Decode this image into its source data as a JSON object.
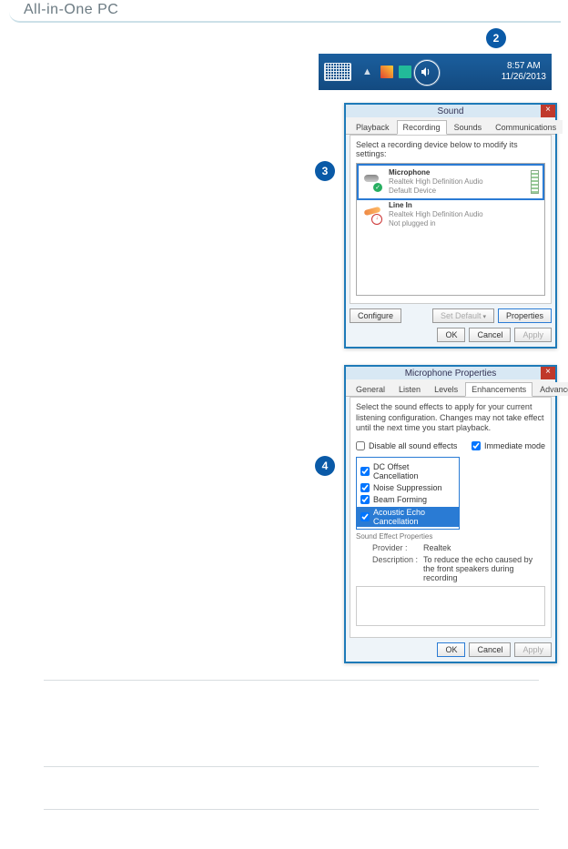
{
  "header": {
    "brand": "All-in-One PC"
  },
  "callouts": {
    "c2": "2",
    "c3": "3",
    "c4": "4"
  },
  "taskbar": {
    "time": "8:57 AM",
    "date": "11/26/2013",
    "chevron": "▲"
  },
  "sound_window": {
    "title": "Sound",
    "close": "×",
    "tabs": [
      "Playback",
      "Recording",
      "Sounds",
      "Communications"
    ],
    "panel_label": "Select a recording device below to modify its settings:",
    "devices": [
      {
        "title": "Microphone",
        "sub1": "Realtek High Definition Audio",
        "sub2": "Default Device"
      },
      {
        "title": "Line In",
        "sub1": "Realtek High Definition Audio",
        "sub2": "Not plugged in"
      }
    ],
    "buttons": {
      "configure": "Configure",
      "set_default": "Set Default",
      "properties": "Properties",
      "ok": "OK",
      "cancel": "Cancel",
      "apply": "Apply"
    }
  },
  "mic_window": {
    "title": "Microphone Properties",
    "close": "×",
    "tabs": [
      "General",
      "Listen",
      "Levels",
      "Enhancements",
      "Advanced"
    ],
    "panel_label": "Select the sound effects to apply for your current listening configuration. Changes may not take effect until the next time you start playback.",
    "disable_all": "Disable all sound effects",
    "immediate": "Immediate mode",
    "effects": [
      "DC Offset Cancellation",
      "Noise Suppression",
      "Beam Forming",
      "Acoustic Echo Cancellation"
    ],
    "fieldset": "Sound Effect Properties",
    "provider_k": "Provider :",
    "provider_v": "Realtek",
    "desc_k": "Description :",
    "desc_v": "To reduce the echo caused by the front speakers during recording",
    "buttons": {
      "ok": "OK",
      "cancel": "Cancel",
      "apply": "Apply"
    }
  }
}
